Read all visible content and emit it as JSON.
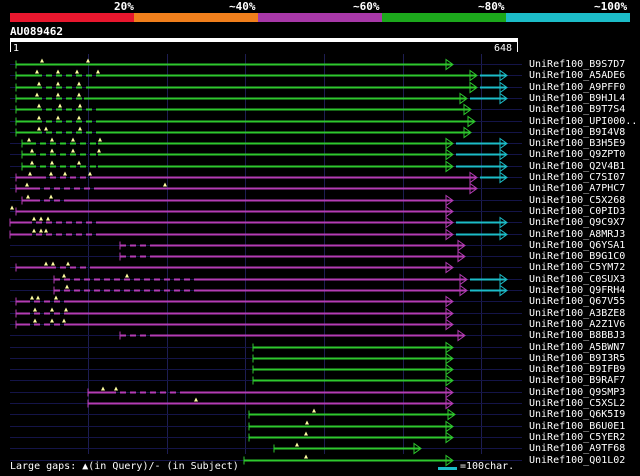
{
  "header": {
    "percent_labels": [
      "20%",
      "~40%",
      "~60%",
      "~80%",
      "~100%"
    ],
    "band_colors": [
      "#e8172e",
      "#f07f1c",
      "#a838a8",
      "#1ca81c",
      "#1cbcc8"
    ]
  },
  "query": {
    "id": "AU089462",
    "start": "1",
    "end": "648"
  },
  "hits": [
    {
      "name": "UniRef100_B9S7D7",
      "color": "green"
    },
    {
      "name": "UniRef100_A5ADE6",
      "color": "green"
    },
    {
      "name": "UniRef100_A9PFF0",
      "color": "green"
    },
    {
      "name": "UniRef100_B9HJL4",
      "color": "green"
    },
    {
      "name": "UniRef100_B9T7S4",
      "color": "green"
    },
    {
      "name": "UniRef100_UPI000..",
      "color": "green"
    },
    {
      "name": "UniRef100_B9I4V8",
      "color": "green"
    },
    {
      "name": "UniRef100_B3H5E9",
      "color": "green"
    },
    {
      "name": "UniRef100_Q9ZPT0",
      "color": "green"
    },
    {
      "name": "UniRef100_Q2V4B1",
      "color": "green"
    },
    {
      "name": "UniRef100_C7SI07",
      "color": "purple"
    },
    {
      "name": "UniRef100_A7PHC7",
      "color": "purple"
    },
    {
      "name": "UniRef100_C5X268",
      "color": "purple"
    },
    {
      "name": "UniRef100_C0PID3",
      "color": "purple"
    },
    {
      "name": "UniRef100_Q9C9X7",
      "color": "purple"
    },
    {
      "name": "UniRef100_A8MRJ3",
      "color": "purple"
    },
    {
      "name": "UniRef100_Q6YSA1",
      "color": "purple"
    },
    {
      "name": "UniRef100_B9G1C0",
      "color": "purple"
    },
    {
      "name": "UniRef100_C5YM72",
      "color": "purple"
    },
    {
      "name": "UniRef100_C0SUX3",
      "color": "purple"
    },
    {
      "name": "UniRef100_Q9FRH4",
      "color": "purple"
    },
    {
      "name": "UniRef100_Q67V55",
      "color": "purple"
    },
    {
      "name": "UniRef100_A3BZE8",
      "color": "purple"
    },
    {
      "name": "UniRef100_A2Z1V6",
      "color": "purple"
    },
    {
      "name": "UniRef100_B8BBJ3",
      "color": "purple"
    },
    {
      "name": "UniRef100_A5BWN7",
      "color": "green"
    },
    {
      "name": "UniRef100_B9I3R5",
      "color": "green"
    },
    {
      "name": "UniRef100_B9IFB9",
      "color": "green"
    },
    {
      "name": "UniRef100_B9RAF7",
      "color": "green"
    },
    {
      "name": "UniRef100_Q9SMP3",
      "color": "purple"
    },
    {
      "name": "UniRef100_C5XSL2",
      "color": "purple"
    },
    {
      "name": "UniRef100_Q6K5I9",
      "color": "green"
    },
    {
      "name": "UniRef100_B6U0E1",
      "color": "green"
    },
    {
      "name": "UniRef100_C5YER2",
      "color": "green"
    },
    {
      "name": "UniRef100_A9TF68",
      "color": "green"
    },
    {
      "name": "UniRef100_Q01L02",
      "color": "green"
    }
  ],
  "legend": {
    "gaps_text": "Large gaps: ▲(in Query)/- (in Subject)",
    "scale_text": "=100char.",
    "scale_color": "#1cbcc8"
  }
}
